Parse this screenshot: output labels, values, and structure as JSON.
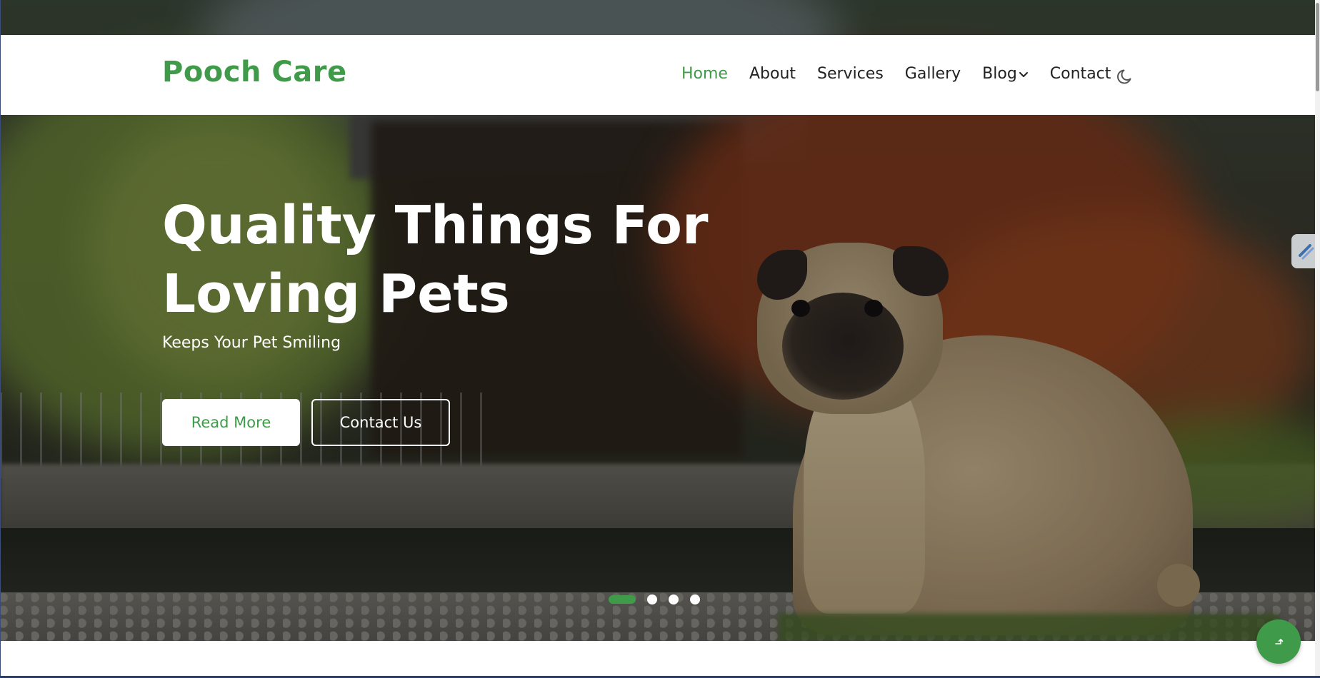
{
  "header": {
    "brand": "Pooch Care",
    "nav": [
      {
        "label": "Home",
        "active": true
      },
      {
        "label": "About",
        "active": false
      },
      {
        "label": "Services",
        "active": false
      },
      {
        "label": "Gallery",
        "active": false
      },
      {
        "label": "Blog",
        "active": false,
        "has_dropdown": true
      },
      {
        "label": "Contact",
        "active": false
      }
    ],
    "theme_toggle_icon": "moon-icon"
  },
  "hero": {
    "title_line1": "Quality Things For",
    "title_line2": "Loving Pets",
    "subtitle": "Keeps Your Pet Smiling",
    "primary_button": "Read More",
    "secondary_button": "Contact Us",
    "carousel": {
      "slides": 4,
      "active_index": 0
    }
  },
  "floating": {
    "scroll_top_icon": "arrow-up-icon",
    "side_tab_icon": "paint-brush-icon"
  },
  "colors": {
    "accent": "#3f9a49",
    "nav_text": "#222222",
    "header_bg": "#ffffff",
    "hero_text": "#ffffff"
  }
}
